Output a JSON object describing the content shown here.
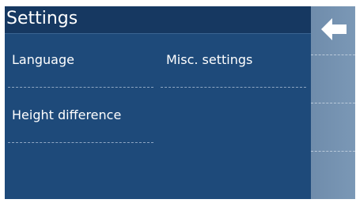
{
  "header": {
    "title": "Settings"
  },
  "menu": {
    "items": [
      {
        "label": "Language"
      },
      {
        "label": "Misc. settings"
      },
      {
        "label": "Height difference"
      }
    ]
  },
  "side_panel": {
    "back_icon": "arrow-left-icon"
  },
  "colors": {
    "background": "#1e4a7a",
    "titlebar": "#163861",
    "side_panel": "#7592b0",
    "text": "#ffffff"
  }
}
